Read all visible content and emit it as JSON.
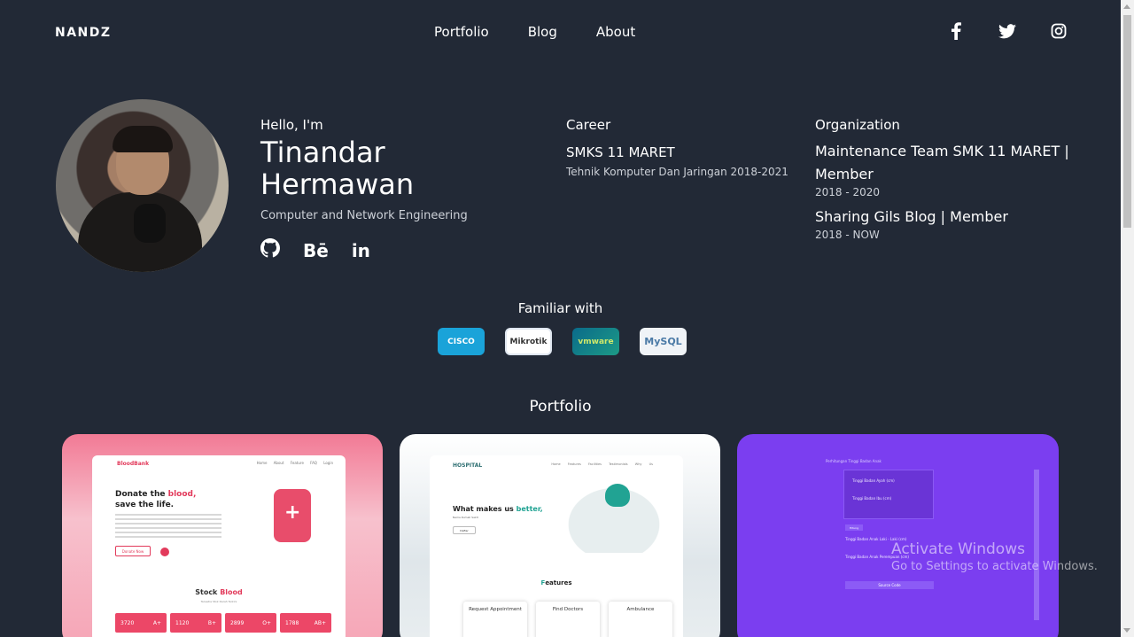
{
  "brand": "NANDZ",
  "nav": {
    "items": [
      {
        "label": "Portfolio"
      },
      {
        "label": "Blog"
      },
      {
        "label": "About"
      }
    ]
  },
  "social_icons": [
    "facebook-icon",
    "twitter-icon",
    "instagram-icon"
  ],
  "profile": {
    "greeting": "Hello, I'm",
    "first_name": "Tinandar",
    "last_name": "Hermawan",
    "role": "Computer and Network Engineering",
    "links": [
      {
        "icon": "github-icon"
      },
      {
        "label": "Bē"
      },
      {
        "label": "in"
      }
    ]
  },
  "career": {
    "title": "Career",
    "school": "SMKS 11 MARET",
    "major": "Tehnik Komputer Dan Jaringan 2018-2021"
  },
  "organization": {
    "title": "Organization",
    "items": [
      {
        "name": "Maintenance Team SMK 11 MARET | Member",
        "period": "2018 - 2020"
      },
      {
        "name": "Sharing Gils Blog | Member",
        "period": "2018 - NOW"
      }
    ]
  },
  "familiar": {
    "title": "Familiar with",
    "logos": [
      {
        "name": "CISCO"
      },
      {
        "name": "Mikrotik"
      },
      {
        "name": "vmware"
      },
      {
        "name": "MySQL"
      }
    ]
  },
  "portfolio": {
    "title": "Portfolio",
    "cards": [
      {
        "brand": "BloodBank",
        "menu": "Home About Feature FAQ Login",
        "hero_prefix": "Donate the",
        "hero_highlight": "blood,",
        "hero_line2": "save the life.",
        "button": "Donate Now",
        "stock_prefix": "Stock",
        "stock_highlight": "Blood",
        "stock_sub": "Tersedia Stok Darah Terkini",
        "blood": [
          {
            "count": "3720",
            "type": "A+"
          },
          {
            "count": "1120",
            "type": "B+"
          },
          {
            "count": "2899",
            "type": "O+"
          },
          {
            "count": "1788",
            "type": "AB+"
          }
        ]
      },
      {
        "brand": "HOSPITAL",
        "menu": "Home Features Facilities Testimonials Why Us",
        "hero_prefix": "What makes us",
        "hero_highlight": "better,",
        "small": "Nama Rumah Sakit",
        "button": "Daftar",
        "features_prefix": "F",
        "features_highlight": "eatures",
        "boxes": [
          "Request Appointment",
          "Find Doctors",
          "Ambulance"
        ]
      },
      {
        "title": "Perhitungan Tinggi Badan Anak",
        "field1": "Tinggi Badan Ayah (cm)",
        "field2": "Tinggi Badan Ibu (cm)",
        "button": "Hitung",
        "result1": "Tinggi Badan Anak Laki - Laki (cm)",
        "result2": "Tinggi Badan Anak Perempuan (cm)",
        "source": "Source Code"
      }
    ]
  },
  "watermark": {
    "line1": "Activate Windows",
    "line2": "Go to Settings to activate Windows."
  }
}
